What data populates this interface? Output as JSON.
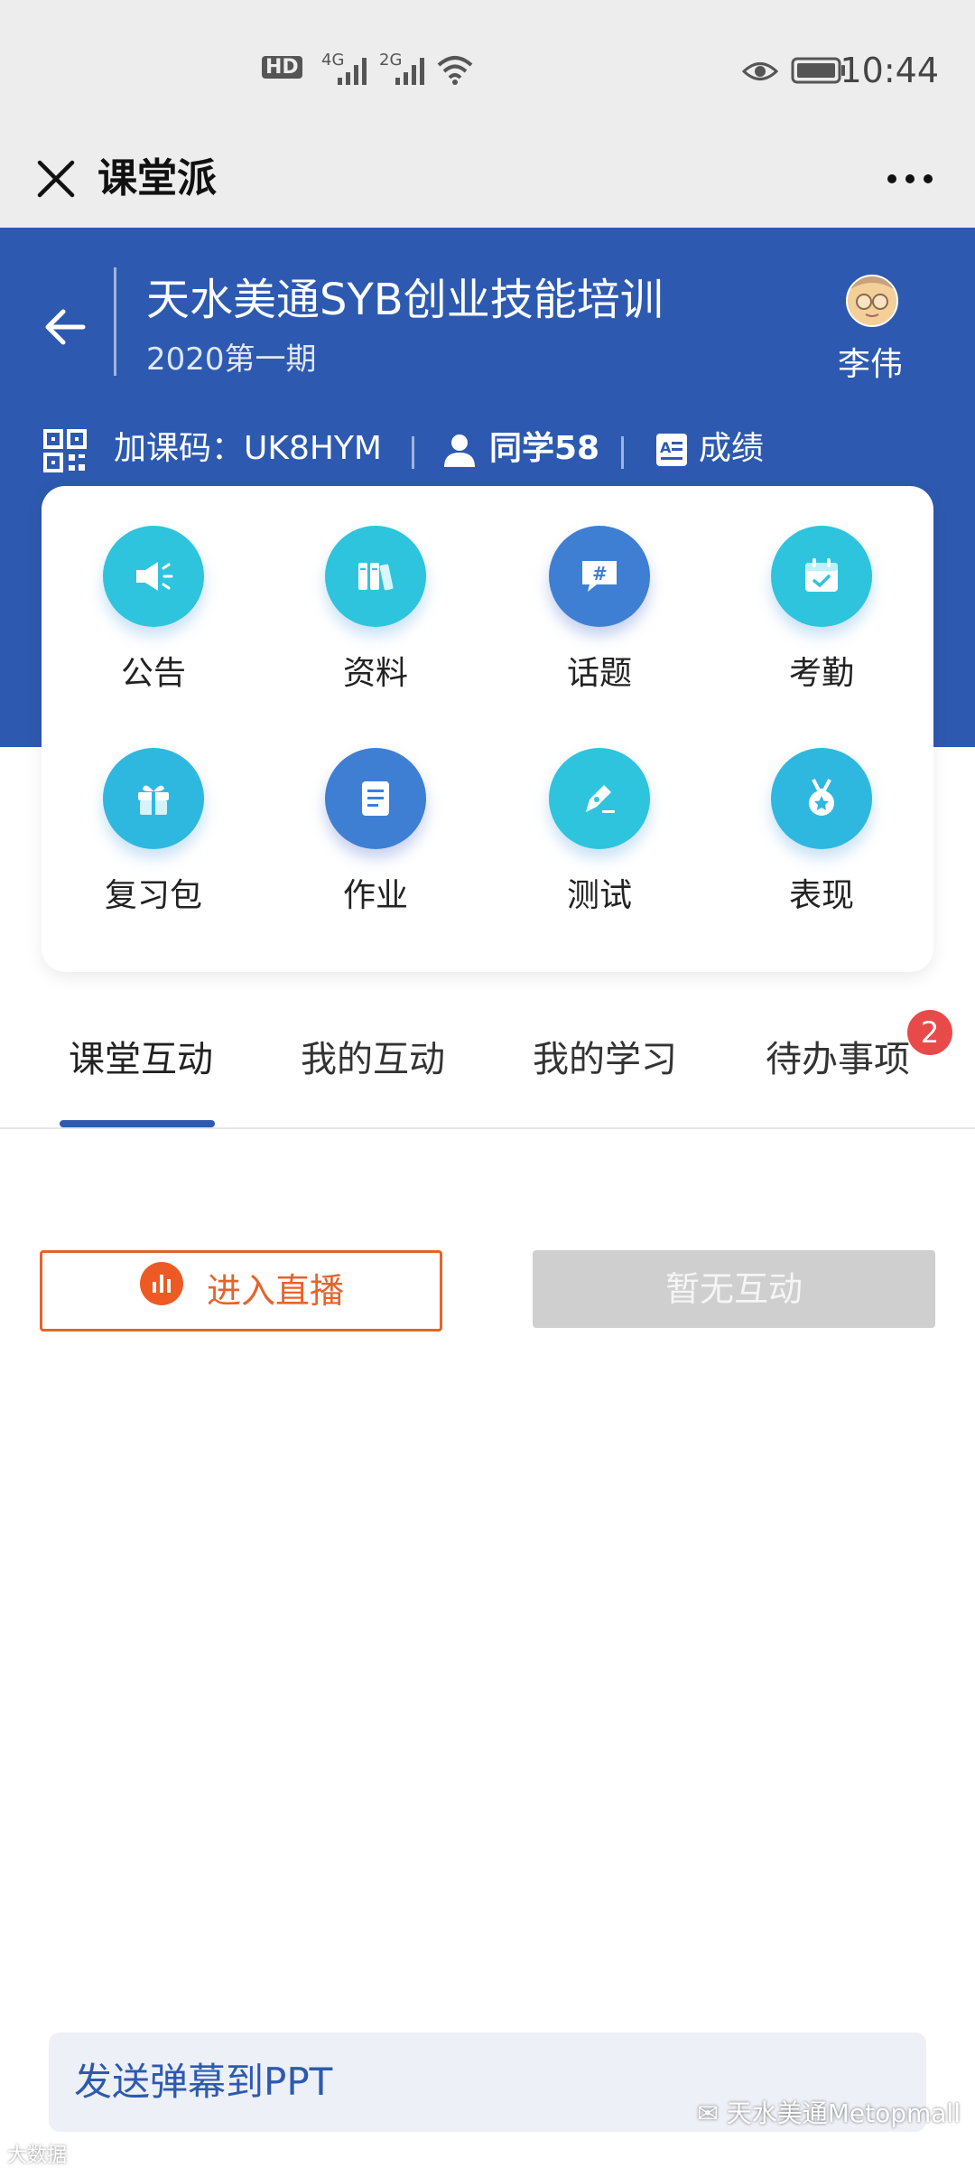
{
  "status_bar": {
    "time": "10:44",
    "hd_label": "HD",
    "sim1_label": "4G",
    "sim2_label": "2G"
  },
  "wechat_nav": {
    "title": "课堂派"
  },
  "course": {
    "title": "天水美通SYB创业技能培训",
    "subtitle": "2020第一期",
    "user_name": "李伟",
    "code_label": "加课码：UK8HYM",
    "classmates_label": "同学58",
    "grades_label": "成绩"
  },
  "menu": [
    {
      "label": "公告",
      "icon": "megaphone-icon",
      "color": "#2ec4dd"
    },
    {
      "label": "资料",
      "icon": "books-icon",
      "color": "#2ec4dd"
    },
    {
      "label": "话题",
      "icon": "hashtag-chat-icon",
      "color": "#3f7fd3"
    },
    {
      "label": "考勤",
      "icon": "calendar-check-icon",
      "color": "#2ec4dd"
    },
    {
      "label": "复习包",
      "icon": "gift-icon",
      "color": "#2eb8e0"
    },
    {
      "label": "作业",
      "icon": "document-icon",
      "color": "#3f7fd3"
    },
    {
      "label": "测试",
      "icon": "pen-icon",
      "color": "#2ec4dd"
    },
    {
      "label": "表现",
      "icon": "medal-icon",
      "color": "#2eb8e0"
    }
  ],
  "tabs": {
    "items": [
      {
        "label": "课堂互动"
      },
      {
        "label": "我的互动"
      },
      {
        "label": "我的学习"
      },
      {
        "label": "待办事项"
      }
    ],
    "todo_badge": "2",
    "active": "课堂互动"
  },
  "actions": {
    "live_label": "进入直播",
    "no_interaction_label": "暂无互动"
  },
  "bottom": {
    "danmaku_label": "发送弹幕到PPT",
    "watermark": "天水美通Metopmall",
    "corner_watermark": "大数据"
  },
  "colors": {
    "brand_blue": "#2d5ab0",
    "live_orange": "#e5632c",
    "badge_red": "#e84a4a"
  }
}
